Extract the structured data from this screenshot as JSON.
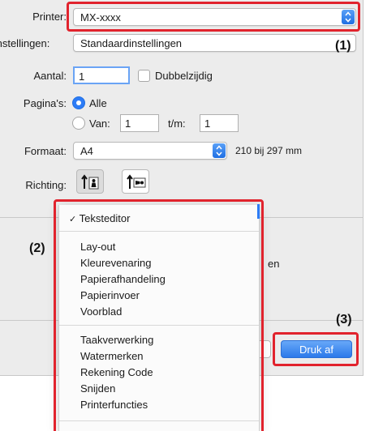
{
  "printer": {
    "label": "Printer:",
    "value": "MX-xxxx"
  },
  "presets": {
    "label": "Instellingen:",
    "value": "Standaardinstellingen"
  },
  "copies": {
    "label": "Aantal:",
    "value": "1",
    "duplex_label": "Dubbelzijdig"
  },
  "pages": {
    "label": "Pagina's:",
    "all_label": "Alle",
    "from_label": "Van:",
    "from_value": "1",
    "to_label": "t/m:",
    "to_value": "1"
  },
  "paper": {
    "label": "Formaat:",
    "value": "A4",
    "size_text": "210 bij 297 mm"
  },
  "orientation": {
    "label": "Richting:"
  },
  "behind_menu_text": "en",
  "menu": {
    "checked_item": "Teksteditor",
    "group1": [
      "Lay-out",
      "Kleurevenaring",
      "Papierafhandeling",
      "Papierinvoer",
      "Voorblad"
    ],
    "group2": [
      "Taakverwerking",
      "Watermerken",
      "Rekening Code",
      "Snijden",
      "Printerfuncties"
    ]
  },
  "buttons": {
    "print_label": "Druk af"
  },
  "callouts": {
    "c1": "(1)",
    "c2": "(2)",
    "c3": "(3)"
  },
  "accent_color": "#2d7cf6",
  "highlight_color": "#e1232d"
}
